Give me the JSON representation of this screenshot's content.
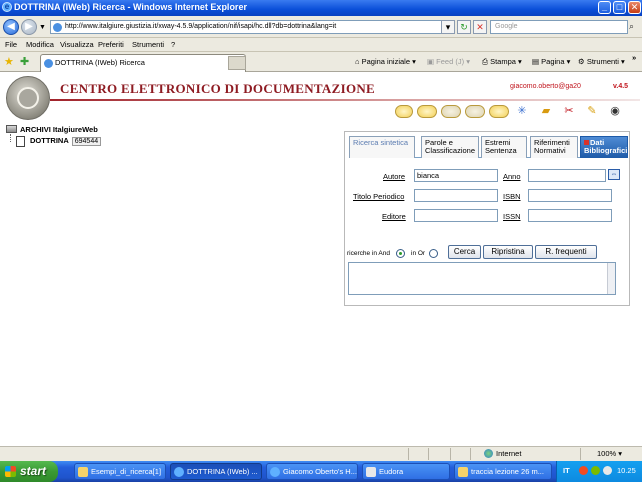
{
  "window": {
    "title": "DOTTRINA (IWeb) Ricerca - Windows Internet Explorer",
    "controls": {
      "minimize": "_",
      "maximize": "□",
      "close": "✕"
    }
  },
  "addressbar": {
    "url": "http://www.italgiure.giustizia.it/xway-4.5.9/application/nif/isapi/hc.dll?db=dottrina&lang=it",
    "search_placeholder": "Google"
  },
  "menubar": {
    "items": [
      "File",
      "Modifica",
      "Visualizza",
      "Preferiti",
      "Strumenti",
      "?"
    ]
  },
  "tabbar": {
    "tab_title": "DOTTRINA (IWeb) Ricerca",
    "tools": {
      "home": "Pagina iniziale",
      "feed": "Feed (J)",
      "print": "Stampa",
      "page": "Pagina",
      "tools": "Strumenti",
      "more": "»"
    }
  },
  "header": {
    "site_title": "CENTRO ELETTRONICO DI DOCUMENTAZIONE",
    "user": "giacomo.oberto@ga20",
    "version": "v.4.5"
  },
  "tree": {
    "root_label": "ARCHIVI ItalgiureWeb",
    "child_label": "DOTTRINA",
    "child_count": "694544"
  },
  "form": {
    "tabs": [
      "Ricerca sintetica",
      "Parole e Classificazione",
      "Estremi Sentenza",
      "Riferimenti Normativi",
      "Dati Bibliografici"
    ],
    "fields": {
      "autore_label": "Autore",
      "autore_value": "bianca",
      "anno_label": "Anno",
      "titolo_label": "Titolo Periodico",
      "isbn_label": "ISBN",
      "editore_label": "Editore",
      "issn_label": "ISSN"
    },
    "swap_symbol": "⇔",
    "radio_and_label": "ricerche in And",
    "radio_or_label": "in Or",
    "buttons": {
      "search": "Cerca",
      "reset": "Ripristina",
      "frequent": "R. frequenti"
    }
  },
  "statusbar": {
    "zone": "Internet",
    "zoom": "100%"
  },
  "taskbar": {
    "start_label": "start",
    "tasks": [
      "Esempi_di_ricerca[1]",
      "DOTTRINA (IWeb) ...",
      "Giacomo Oberto's H...",
      "Eudora",
      "traccia lezione 26 m..."
    ],
    "lang": "IT",
    "clock": "10.25"
  }
}
